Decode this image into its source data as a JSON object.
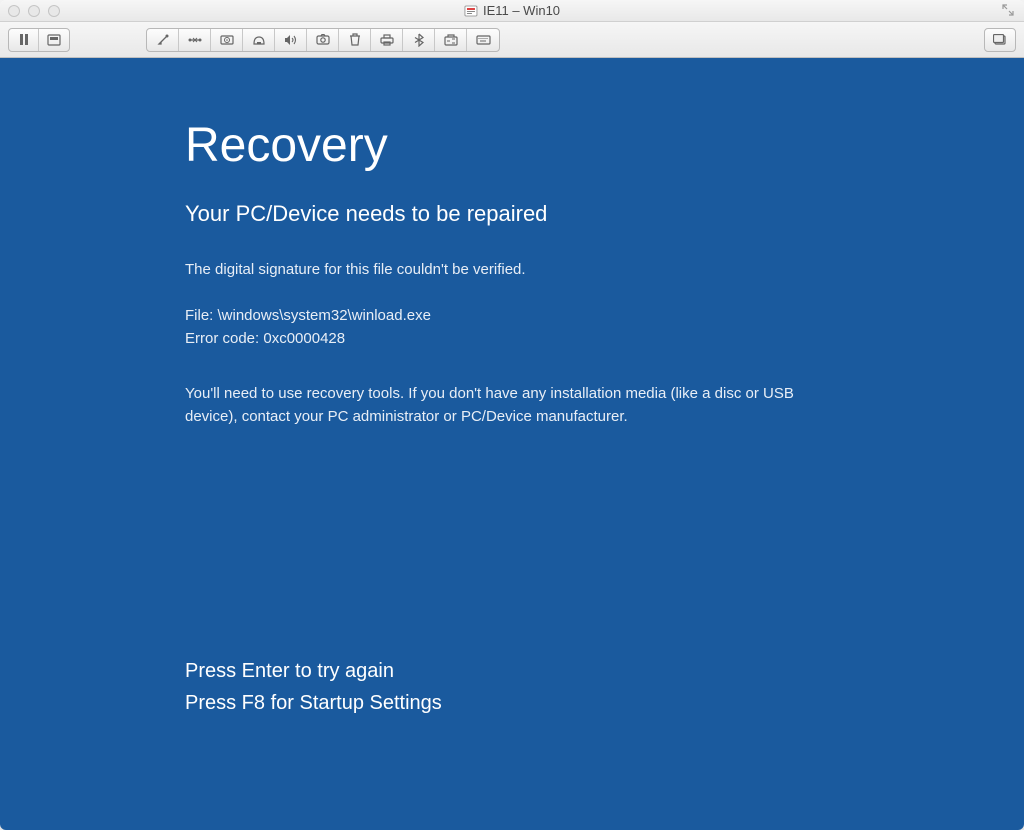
{
  "window": {
    "title": "IE11 – Win10"
  },
  "recovery": {
    "title": "Recovery",
    "subtitle": "Your PC/Device needs to be repaired",
    "message": "The digital signature for this file couldn't be verified.",
    "file_label": "File: \\windows\\system32\\winload.exe",
    "error_label": "Error code: 0xc0000428",
    "instructions": "You'll need to use recovery tools. If you don't have any installation media (like a disc or USB device), contact your PC administrator or PC/Device manufacturer.",
    "action_enter": "Press Enter to try again",
    "action_f8": "Press F8 for Startup Settings"
  },
  "colors": {
    "screen_blue": "#1a5a9e"
  }
}
